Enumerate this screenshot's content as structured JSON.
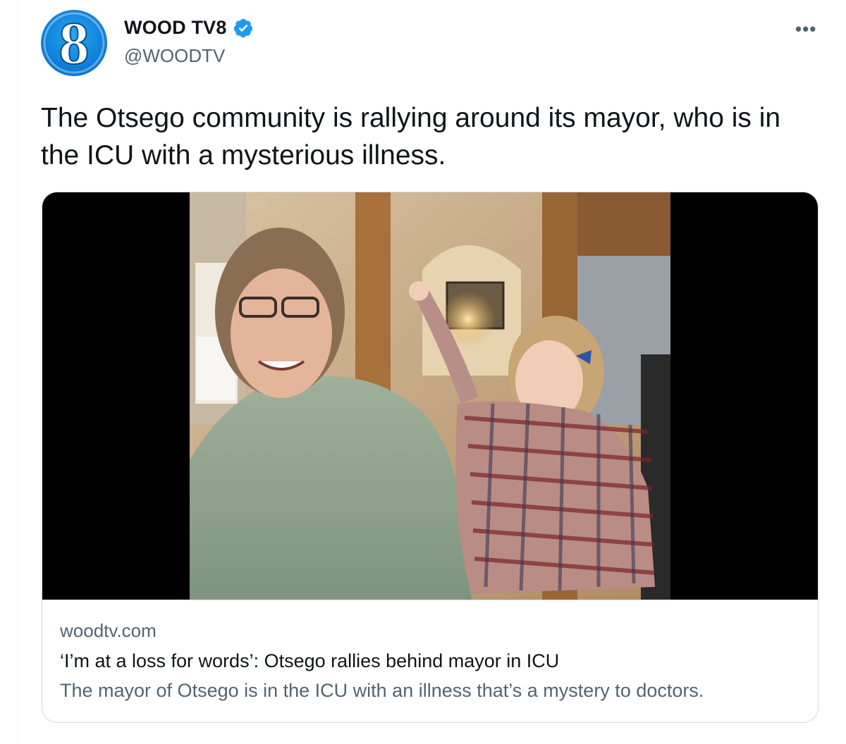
{
  "tweet": {
    "author_name": "WOOD TV8",
    "handle": "@WOODTV",
    "text": "The Otsego community is rallying around its mayor, who is in the ICU with a mysterious illness.",
    "verified": true,
    "more_icon": "ellipsis-icon",
    "avatar_logo_text": "8"
  },
  "card": {
    "domain": "woodtv.com",
    "title": "‘I’m at a loss for words’: Otsego rallies behind mayor in ICU",
    "description": "The mayor of Otsego is in the ICU with an illness that’s a mystery to doctors."
  },
  "colors": {
    "text_primary": "#0f1419",
    "text_secondary": "#536471",
    "verified_blue": "#1d9bf0",
    "border": "#cfd9de"
  }
}
